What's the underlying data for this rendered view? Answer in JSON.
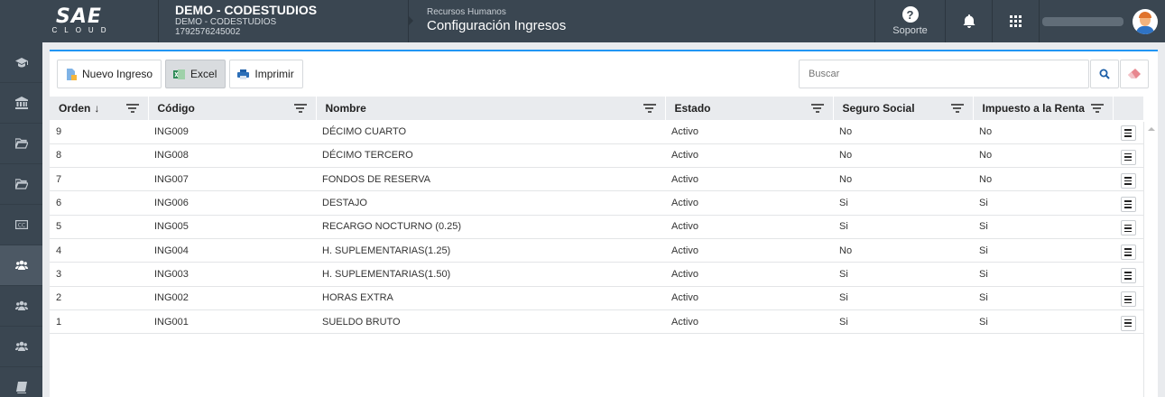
{
  "header": {
    "logo_mark": "SAE",
    "logo_sub": "CLOUD",
    "company_name": "DEMO - CODESTUDIOS",
    "company_sub": "DEMO - CODESTUDIOS",
    "company_id": "1792576245002",
    "module_crumb": "Recursos Humanos",
    "page_title": "Configuración Ingresos",
    "support_label": "Soporte"
  },
  "sidebar": {
    "items": [
      {
        "icon": "graduation-cap-icon"
      },
      {
        "icon": "bank-icon"
      },
      {
        "icon": "folder-icon"
      },
      {
        "icon": "folder-icon"
      },
      {
        "icon": "cc-icon"
      },
      {
        "icon": "users-icon",
        "active": true
      },
      {
        "icon": "users-icon"
      },
      {
        "icon": "users-icon"
      },
      {
        "icon": "book-icon"
      }
    ]
  },
  "toolbar": {
    "new_label": "Nuevo Ingreso",
    "excel_label": "Excel",
    "print_label": "Imprimir",
    "search_placeholder": "Buscar"
  },
  "table": {
    "columns": [
      "Orden",
      "Código",
      "Nombre",
      "Estado",
      "Seguro Social",
      "Impuesto a la Renta"
    ],
    "sort_indicator": "↓",
    "rows": [
      [
        "9",
        "ING009",
        "DÉCIMO CUARTO",
        "Activo",
        "No",
        "No"
      ],
      [
        "8",
        "ING008",
        "DÉCIMO TERCERO",
        "Activo",
        "No",
        "No"
      ],
      [
        "7",
        "ING007",
        "FONDOS DE RESERVA",
        "Activo",
        "No",
        "No"
      ],
      [
        "6",
        "ING006",
        "DESTAJO",
        "Activo",
        "Si",
        "Si"
      ],
      [
        "5",
        "ING005",
        "RECARGO NOCTURNO (0.25)",
        "Activo",
        "Si",
        "Si"
      ],
      [
        "4",
        "ING004",
        "H. SUPLEMENTARIAS(1.25)",
        "Activo",
        "No",
        "Si"
      ],
      [
        "3",
        "ING003",
        "H. SUPLEMENTARIAS(1.50)",
        "Activo",
        "Si",
        "Si"
      ],
      [
        "2",
        "ING002",
        "HORAS EXTRA",
        "Activo",
        "Si",
        "Si"
      ],
      [
        "1",
        "ING001",
        "SUELDO BRUTO",
        "Activo",
        "Si",
        "Si"
      ]
    ]
  },
  "colors": {
    "header_bg": "#3a4651",
    "accent": "#2196f3"
  }
}
